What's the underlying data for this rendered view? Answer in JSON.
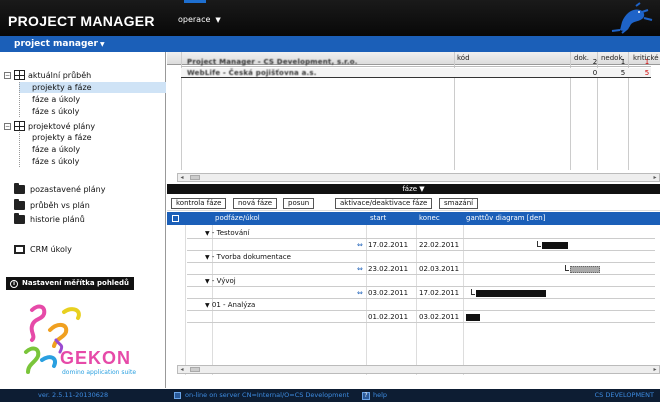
{
  "app": {
    "title": "PROJECT MANAGER"
  },
  "top_menu": {
    "label": "operace"
  },
  "nav": {
    "project_manager": "project manager"
  },
  "tree": {
    "group1": {
      "label": "aktuální průběh",
      "children": [
        "projekty a fáze",
        "fáze a úkoly",
        "fáze s úkoly"
      ]
    },
    "group2": {
      "label": "projektové plány",
      "children": [
        "projekty a fáze",
        "fáze a úkoly",
        "fáze s úkoly"
      ]
    },
    "folders": [
      "pozastavené plány",
      "průběh vs plán",
      "historie plánů"
    ],
    "crm": "CRM úkoly"
  },
  "settings": {
    "title": "Nastavení měřítka pohledů"
  },
  "logo": {
    "name": "GEKON",
    "tagline": "domino application suite"
  },
  "upper_grid": {
    "columns": [
      "kód",
      "dok.",
      "nedok.",
      "kritické"
    ],
    "rows": [
      {
        "name": "Project Manager - CS Development, s.r.o.",
        "dok": "2",
        "nedok": "1",
        "krit": "1"
      },
      {
        "name": "WebLife - Česká pojišťovna a.s.",
        "dok": "0",
        "nedok": "5",
        "krit": "5"
      }
    ]
  },
  "faze_bar": {
    "label": "fáze"
  },
  "toolbar": {
    "buttons": [
      "kontrola fáze",
      "nová fáze",
      "posun",
      "aktivace/deaktivace fáze",
      "smazání"
    ]
  },
  "lower_grid": {
    "columns": [
      "podfáze/úkol",
      "start",
      "konec",
      "ganttův diagram [den]"
    ],
    "groups": [
      {
        "name": "- Testování",
        "start": "17.02.2011",
        "end": "22.02.2011"
      },
      {
        "name": "- Tvorba dokumentace",
        "start": "23.02.2011",
        "end": "02.03.2011"
      },
      {
        "name": "- Vývoj",
        "start": "03.02.2011",
        "end": "17.02.2011"
      },
      {
        "name": "01 - Analýza",
        "start": "01.02.2011",
        "end": "03.02.2011"
      }
    ]
  },
  "footer": {
    "version": "ver. 2.5.11-20130628",
    "server": "on-line on server CN=Internal/O=CS Development",
    "help": "help",
    "company": "CS DEVELOPMENT"
  },
  "colors": {
    "topbar": "#0b0b0b",
    "accent_blue": "#1b5fb8",
    "footer": "#0d1d33",
    "critical_red": "#cc0000"
  }
}
